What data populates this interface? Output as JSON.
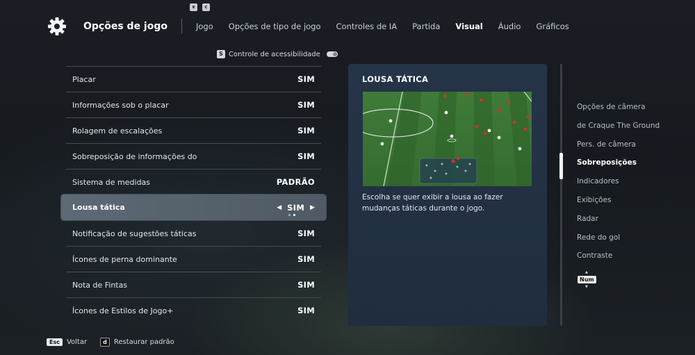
{
  "hints": {
    "x_key": "x",
    "c_key": "c"
  },
  "header": {
    "title": "Opções de jogo",
    "tabs": [
      {
        "label": "Jogo"
      },
      {
        "label": "Opções de tipo de jogo"
      },
      {
        "label": "Controles de IA"
      },
      {
        "label": "Partida"
      },
      {
        "label": "Visual",
        "active": true
      },
      {
        "label": "Áudio"
      },
      {
        "label": "Gráficos"
      }
    ]
  },
  "accessibility": {
    "key": "S",
    "label": "Controle de acessibilidade"
  },
  "settings": [
    {
      "label": "Placar",
      "value": "SIM"
    },
    {
      "label": "Informações sob o placar",
      "value": "SIM"
    },
    {
      "label": "Rolagem de escalações",
      "value": "SIM"
    },
    {
      "label": "Sobreposição de informações do",
      "value": "SIM"
    },
    {
      "label": "Sistema de medidas",
      "value": "PADRÃO"
    },
    {
      "label": "Lousa tática",
      "value": "SIM",
      "selected": true
    },
    {
      "label": "Notificação de sugestões táticas",
      "value": "SIM"
    },
    {
      "label": "Ícones de perna dominante",
      "value": "SIM"
    },
    {
      "label": "Nota de Fintas",
      "value": "SIM"
    },
    {
      "label": "Ícones de Estilos de Jogo+",
      "value": "SIM"
    }
  ],
  "selected_arrows": {
    "left": "◀",
    "right": "▶"
  },
  "detail": {
    "title": "LOUSA TÁTICA",
    "description": "Escolha se quer exibir a lousa ao fazer mudanças táticas durante o jogo."
  },
  "side_nav": [
    {
      "label": "Opções de câmera"
    },
    {
      "label": "de Craque The Ground"
    },
    {
      "label": "Pers. de câmera"
    },
    {
      "label": "Sobreposições",
      "active": true
    },
    {
      "label": "Indicadores"
    },
    {
      "label": "Exibições"
    },
    {
      "label": "Radar"
    },
    {
      "label": "Rede do gol"
    },
    {
      "label": "Contraste"
    }
  ],
  "num_badge": "Num",
  "footer": {
    "back_key": "Esc",
    "back_label": "Voltar",
    "restore_key": "d",
    "restore_label": "Restaurar padrão"
  }
}
